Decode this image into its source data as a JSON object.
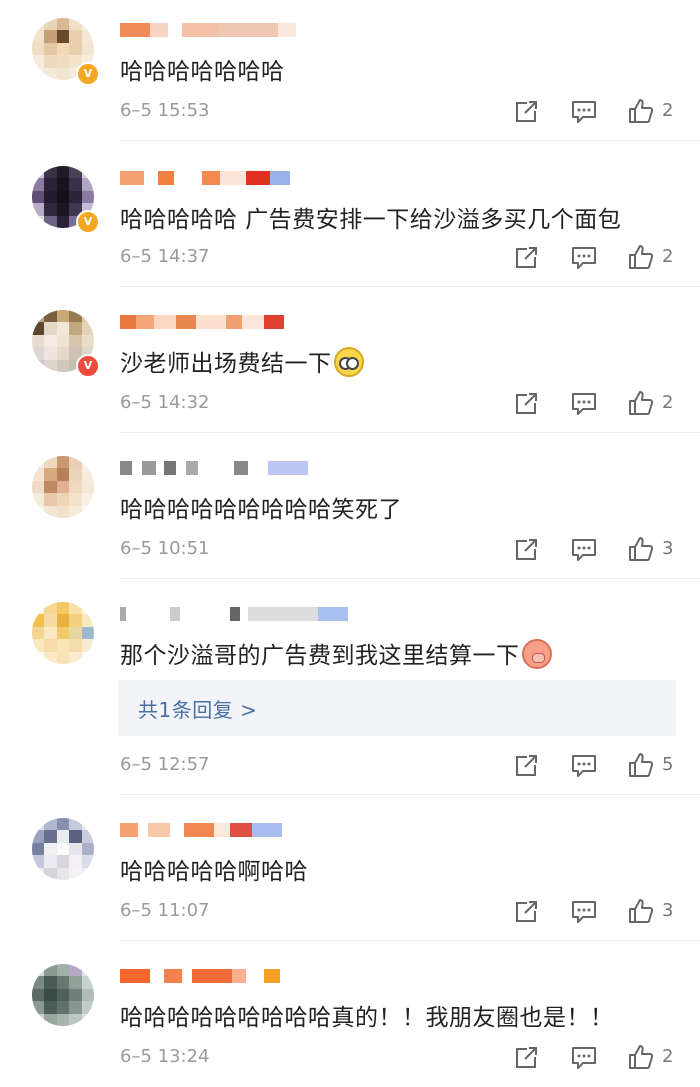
{
  "comments": [
    {
      "text": "哈哈哈哈哈哈哈",
      "time": "6–5 15:53",
      "likes": "2",
      "emoji": "",
      "badge": "V"
    },
    {
      "text": "哈哈哈哈哈 广告费安排一下给沙溢多买几个面包",
      "time": "6–5 14:37",
      "likes": "2",
      "emoji": "",
      "badge": "V"
    },
    {
      "text": "沙老师出场费结一下",
      "time": "6–5 14:32",
      "likes": "2",
      "emoji": "surprise-emoji",
      "badge": "V"
    },
    {
      "text": "哈哈哈哈哈哈哈哈哈笑死了",
      "time": "6–5 10:51",
      "likes": "3",
      "emoji": "",
      "badge": ""
    },
    {
      "text": "那个沙溢哥的广告费到我这里结算一下",
      "time": "6–5 12:57",
      "likes": "5",
      "emoji": "pig-emoji",
      "badge": "",
      "reply": "共1条回复 >"
    },
    {
      "text": "哈哈哈哈哈啊哈哈",
      "time": "6–5 11:07",
      "likes": "3",
      "emoji": "",
      "badge": ""
    },
    {
      "text": "哈哈哈哈哈哈哈哈哈真的！！我朋友圈也是！！",
      "time": "6–5 13:24",
      "likes": "2",
      "emoji": "",
      "badge": ""
    }
  ],
  "icons": {
    "share": "share-icon",
    "comment": "comment-icon",
    "like": "thumbs-up-icon"
  },
  "colors": {
    "reply_link": "#4a6fa5",
    "reply_bg": "#f2f4f7",
    "meta": "#9a9a9a"
  }
}
